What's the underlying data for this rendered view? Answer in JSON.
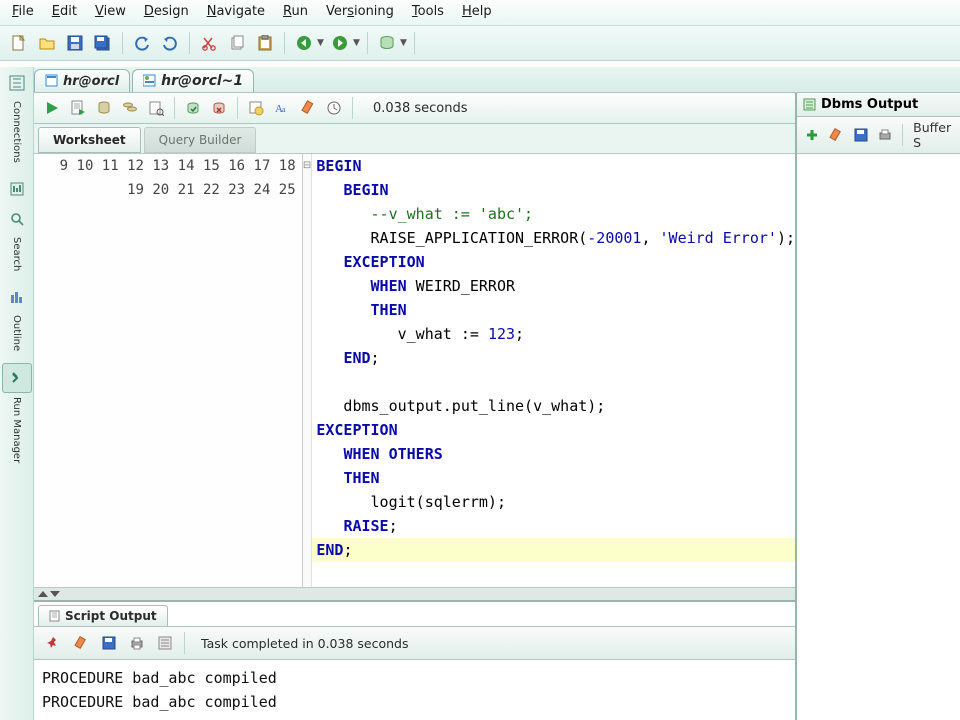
{
  "menu": {
    "file": "File",
    "edit": "Edit",
    "view": "View",
    "design": "Design",
    "navigate": "Navigate",
    "run": "Run",
    "versioning": "Versioning",
    "tools": "Tools",
    "help": "Help"
  },
  "tabs": [
    {
      "label": "hr@orcl"
    },
    {
      "label": "hr@orcl~1"
    }
  ],
  "active_tab": 1,
  "worksheet": {
    "tabs": {
      "worksheet": "Worksheet",
      "qbuilder": "Query Builder"
    },
    "time_label": "0.038 seconds"
  },
  "code_lines": [
    {
      "n": 9,
      "raw": "BEGIN",
      "cls": "kw",
      "fold": ""
    },
    {
      "n": 10,
      "raw": "   BEGIN",
      "fold": "⊟",
      "tokens": [
        [
          "   ",
          ""
        ],
        [
          "BEGIN",
          "kw"
        ]
      ]
    },
    {
      "n": 11,
      "raw": "      --v_what := 'abc';",
      "tokens": [
        [
          "      ",
          ""
        ],
        [
          "--v_what := 'abc';",
          "cmt"
        ]
      ]
    },
    {
      "n": 12,
      "raw": "      RAISE_APPLICATION_ERROR(-20001, 'Weird Error');",
      "tokens": [
        [
          "      ",
          ""
        ],
        [
          "RAISE_APPLICATION_ERROR",
          ""
        ],
        [
          "(",
          ""
        ],
        [
          "-20001",
          "num"
        ],
        [
          ", ",
          ""
        ],
        [
          "'Weird Error'",
          "str"
        ],
        [
          ");",
          ""
        ]
      ]
    },
    {
      "n": 13,
      "raw": "   EXCEPTION",
      "tokens": [
        [
          "   ",
          ""
        ],
        [
          "EXCEPTION",
          "kw"
        ]
      ]
    },
    {
      "n": 14,
      "raw": "      WHEN WEIRD_ERROR",
      "tokens": [
        [
          "      ",
          ""
        ],
        [
          "WHEN",
          "kw"
        ],
        [
          " ",
          ""
        ],
        [
          "WEIRD_ERROR",
          ""
        ]
      ]
    },
    {
      "n": 15,
      "raw": "      THEN",
      "tokens": [
        [
          "      ",
          ""
        ],
        [
          "THEN",
          "kw"
        ]
      ]
    },
    {
      "n": 16,
      "raw": "         v_what := 123;",
      "tokens": [
        [
          "         v_what := ",
          ""
        ],
        [
          "123",
          "num"
        ],
        [
          ";",
          ""
        ]
      ]
    },
    {
      "n": 17,
      "raw": "   END;",
      "tokens": [
        [
          "   ",
          ""
        ],
        [
          "END",
          "kw"
        ],
        [
          ";",
          ""
        ]
      ]
    },
    {
      "n": 18,
      "raw": ""
    },
    {
      "n": 19,
      "raw": "   dbms_output.put_line(v_what);",
      "tokens": [
        [
          "   dbms_output.put_line(v_what);",
          ""
        ]
      ]
    },
    {
      "n": 20,
      "raw": "EXCEPTION",
      "tokens": [
        [
          "",
          ""
        ],
        [
          "EXCEPTION",
          "kw"
        ]
      ]
    },
    {
      "n": 21,
      "raw": "   WHEN OTHERS",
      "tokens": [
        [
          "   ",
          ""
        ],
        [
          "WHEN",
          "kw"
        ],
        [
          " ",
          ""
        ],
        [
          "OTHERS",
          "kw"
        ]
      ]
    },
    {
      "n": 22,
      "raw": "   THEN",
      "tokens": [
        [
          "   ",
          ""
        ],
        [
          "THEN",
          "kw"
        ]
      ]
    },
    {
      "n": 23,
      "raw": "      logit(sqlerrm);",
      "tokens": [
        [
          "      logit(sqlerrm);",
          ""
        ]
      ]
    },
    {
      "n": 24,
      "raw": "   RAISE;",
      "tokens": [
        [
          "   ",
          ""
        ],
        [
          "RAISE",
          "kw"
        ],
        [
          ";",
          ""
        ]
      ]
    },
    {
      "n": 25,
      "raw": "END;",
      "hl": true,
      "tokens": [
        [
          "",
          ""
        ],
        [
          "END",
          "kw"
        ],
        [
          ";",
          ""
        ]
      ]
    }
  ],
  "script_output": {
    "tab": "Script Output",
    "status": "Task completed in 0.038 seconds",
    "lines": [
      "PROCEDURE bad_abc compiled",
      "PROCEDURE bad_abc compiled"
    ]
  },
  "dbms": {
    "title": "Dbms Output",
    "buffer": "Buffer S"
  },
  "sidebar": {
    "connections": "Connections",
    "search": "Search",
    "outline": "Outline",
    "runmgr": "Run Manager"
  }
}
